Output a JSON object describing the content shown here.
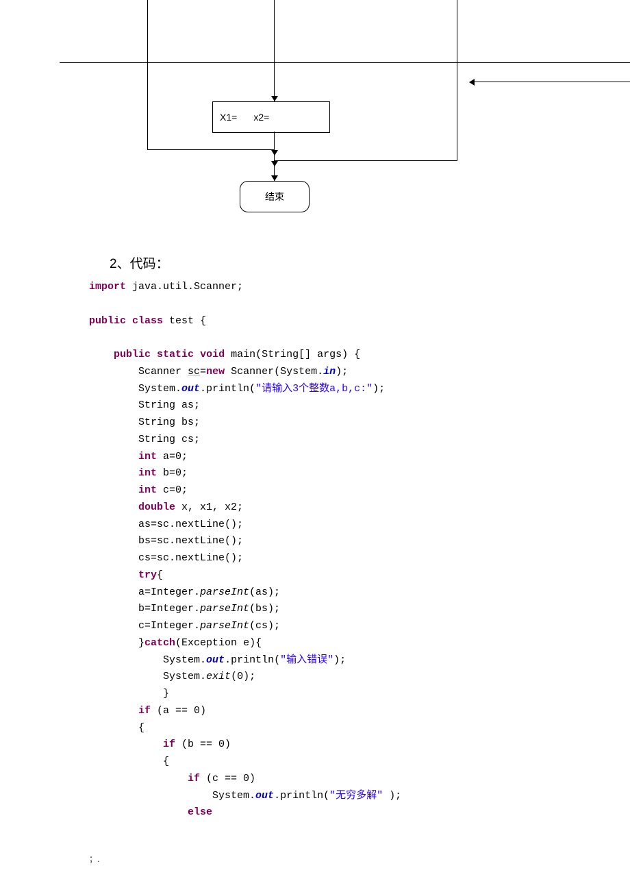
{
  "flow": {
    "rect_x1": "X1=",
    "rect_x2": "x2=",
    "end_label": "结束"
  },
  "heading": "2、代码：",
  "code": {
    "l1": "import",
    "l1b": " java.util.Scanner;",
    "l2a": "public",
    "l2b": "class",
    "l2c": " test {",
    "l3a": "public",
    "l3b": "static",
    "l3c": "void",
    "l3d": " main(String[] args) {",
    "l4a": "Scanner ",
    "l4sc": "sc",
    "l4b": "=",
    "l4new": "new",
    "l4c": " Scanner(System.",
    "l4in": "in",
    "l4d": ");",
    "l5a": "System.",
    "l5out": "out",
    "l5b": ".println(",
    "l5s": "\"请输入3个整数a,b,c:\"",
    "l5c": ");",
    "l6": "String as;",
    "l7": "String bs;",
    "l8": "String cs;",
    "l9a": "int",
    "l9b": " a=0;",
    "l10b": " b=0;",
    "l11b": " c=0;",
    "l12a": "double",
    "l12b": " x, x1, x2;",
    "l13": "as=sc.nextLine();",
    "l14": "bs=sc.nextLine();",
    "l15": "cs=sc.nextLine();",
    "l16": "try",
    "l16b": "{",
    "l17a": "a=Integer.",
    "l17p": "parseInt",
    "l17b": "(as);",
    "l18b": "(bs);",
    "l18a": "b=Integer.",
    "l19a": "c=Integer.",
    "l19b": "(cs);",
    "l20a": "}",
    "l20c": "catch",
    "l20b": "(Exception e){",
    "l21a": "System.",
    "l21b": ".println(",
    "l21s": "\"输入错误\"",
    "l21c": ");",
    "l22a": "System.",
    "l22e": "exit",
    "l22b": "(0);",
    "l23": "}",
    "l24a": "if",
    "l24b": " (a == 0)",
    "l25": "{",
    "l26b": " (b == 0)",
    "l28b": " (c == 0)",
    "l29b": ".println(",
    "l29s": "\"无穷多解\"",
    "l29c": " );",
    "l30": "else"
  },
  "footer": "；."
}
